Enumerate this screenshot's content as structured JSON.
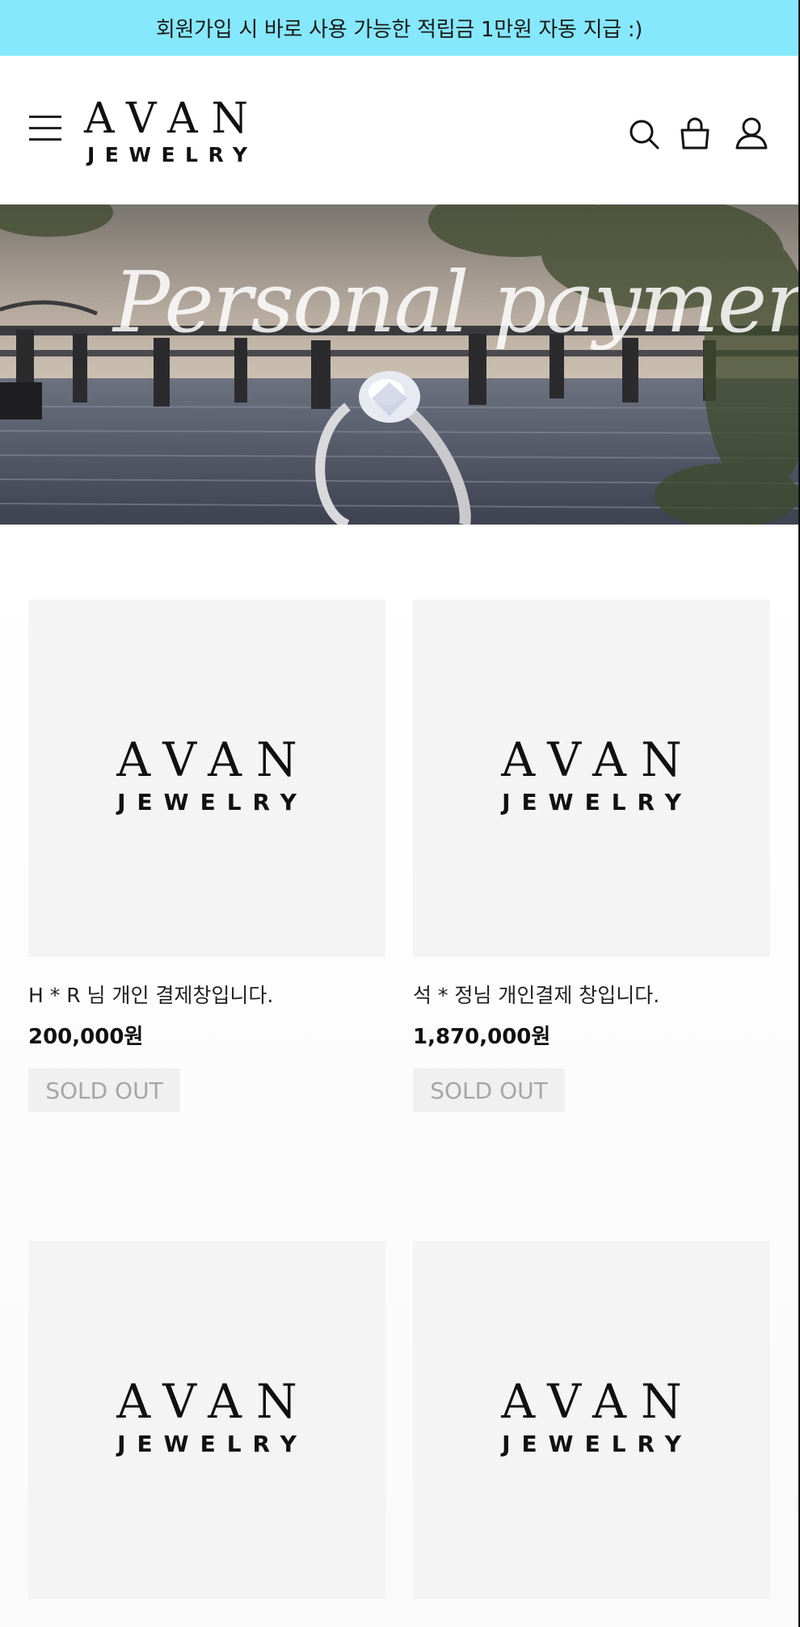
{
  "promo": {
    "text": "회원가입 시 바로 사용 가능한 적립금 1만원 자동 지급 :)"
  },
  "header": {
    "logo_line1": "AVAN",
    "logo_line2": "JEWELRY",
    "icons": [
      "menu-icon",
      "search-icon",
      "shopping-bag-icon",
      "user-icon"
    ]
  },
  "banner": {
    "title": "Personal payment"
  },
  "products": [
    {
      "thumb_line1": "AVAN",
      "thumb_line2": "JEWELRY",
      "name": "H * R 님 개인 결제창입니다.",
      "price": "200,000원",
      "status": "SOLD OUT"
    },
    {
      "thumb_line1": "AVAN",
      "thumb_line2": "JEWELRY",
      "name": "석 * 정님 개인결제 창입니다.",
      "price": "1,870,000원",
      "status": "SOLD OUT"
    },
    {
      "thumb_line1": "AVAN",
      "thumb_line2": "JEWELRY"
    },
    {
      "thumb_line1": "AVAN",
      "thumb_line2": "JEWELRY"
    }
  ],
  "colors": {
    "promo_bg": "#86e8fd",
    "thumb_bg": "#f4f4f4",
    "soldout_bg": "#f0f0f0",
    "soldout_text": "#a6a6a6"
  }
}
